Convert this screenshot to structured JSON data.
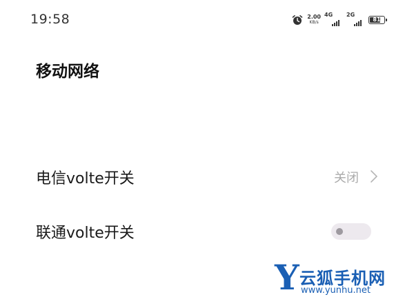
{
  "status_bar": {
    "time": "19:58",
    "net_speed_value": "2.00",
    "net_speed_unit": "KB/s",
    "sim1_network": "4G",
    "sim2_network": "2G",
    "battery_level": "81"
  },
  "page": {
    "title": "移动网络"
  },
  "rows": {
    "telecom_volte": {
      "label": "电信volte开关",
      "value": "关闭"
    },
    "unicom_volte": {
      "label": "联通volte开关",
      "toggle_on": false
    }
  },
  "watermark": {
    "logo_letter": "Y",
    "name": "云狐手机网",
    "url": "www.yunhu.net"
  },
  "icons": {
    "alarm": "alarm-clock-icon",
    "chevron": "chevron-right-icon"
  },
  "colors": {
    "accent": "#1a5fb4",
    "secondary_text": "#aaaaaa",
    "toggle_off_track": "#ede9ee"
  }
}
